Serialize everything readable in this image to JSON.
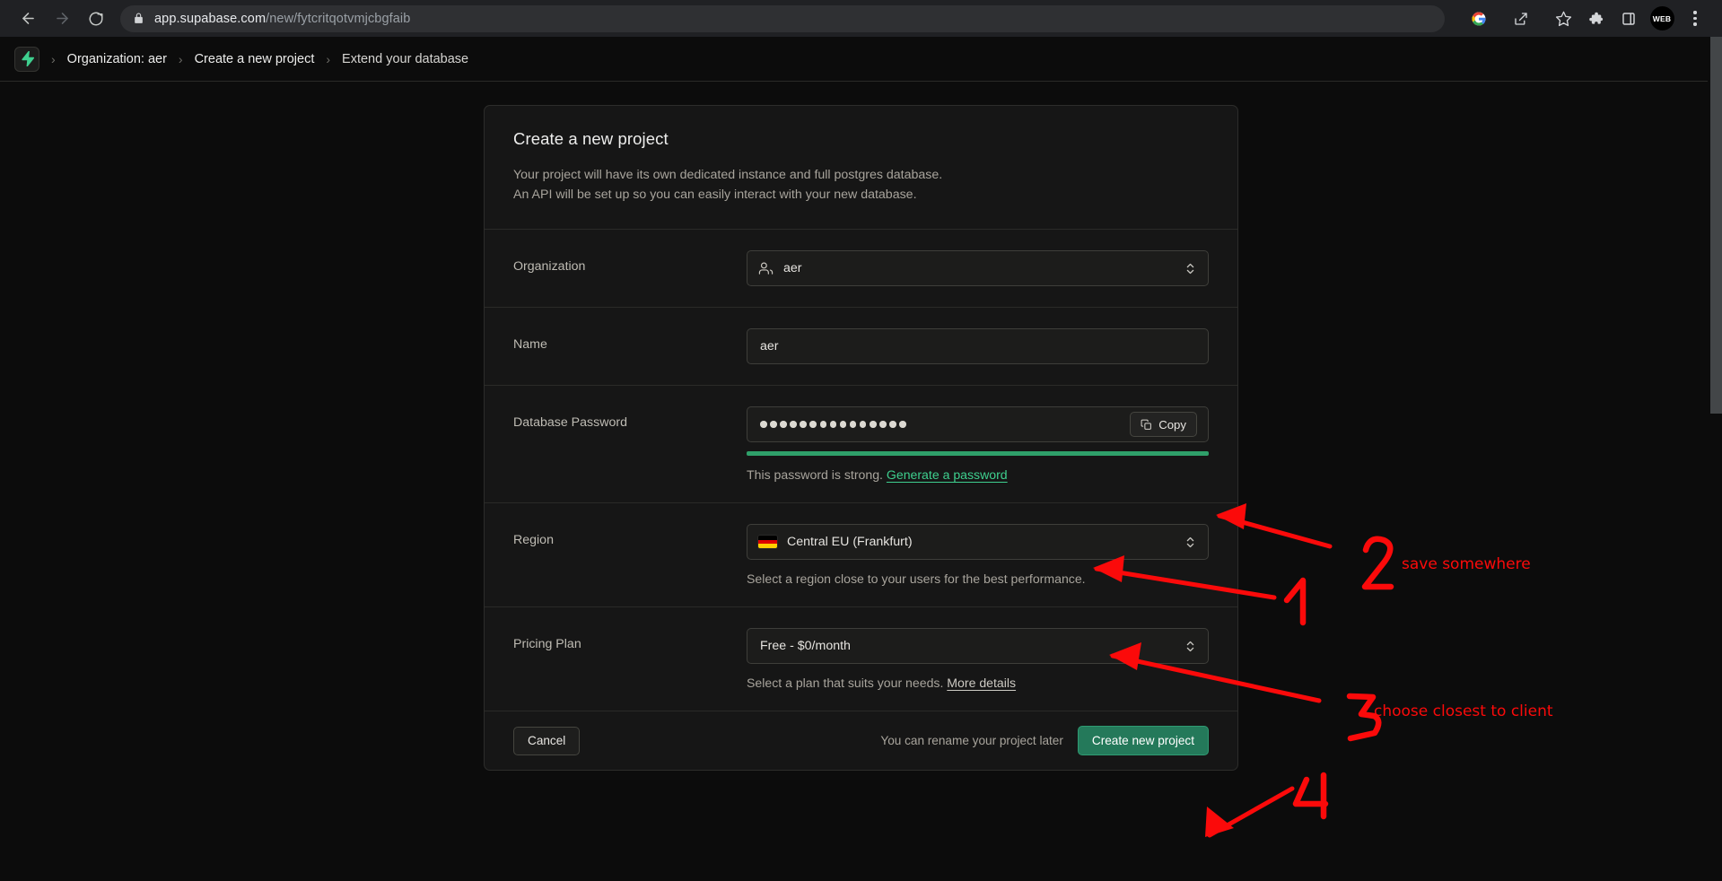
{
  "browser": {
    "back_icon": "arrow-left-icon",
    "forward_icon": "arrow-right-icon",
    "reload_icon": "reload-icon",
    "lock_icon": "lock-icon",
    "url_host": "app.supabase.com",
    "url_path": "/new/fytcritqotvmjcbgfaib",
    "url_full": "app.supabase.com/new/fytcritqotvmjcbgfaib",
    "toolbar_icons": [
      "google-icon",
      "share-icon",
      "bookmark-star-icon",
      "extensions-puzzle-icon",
      "side-panel-icon"
    ],
    "profile_label": "WEB",
    "menu_icon": "three-dot-menu-icon"
  },
  "breadcrumb": {
    "logo_icon": "supabase-lightning-icon",
    "separator": "›",
    "items": [
      {
        "label": "Organization: aer"
      },
      {
        "label": "Create a new project"
      },
      {
        "label": "Extend your database"
      }
    ]
  },
  "card": {
    "title": "Create a new project",
    "description_line1": "Your project will have its own dedicated instance and full postgres database.",
    "description_line2": "An API will be set up so you can easily interact with your new database.",
    "organization": {
      "label": "Organization",
      "icon": "users-icon",
      "value": "aer",
      "chevron_icon": "chevron-up-down-icon"
    },
    "name": {
      "label": "Name",
      "value": "aer",
      "placeholder": "Project name"
    },
    "password": {
      "label": "Database Password",
      "masked_value": "●●●●●●●●●●●●●●●",
      "dot_count": 15,
      "placeholder": "Type in a strong password",
      "copy_label": "Copy",
      "copy_icon": "copy-icon",
      "strength_text": "This password is strong.",
      "generate_link": "Generate a password",
      "strength_color": "#2fa06a",
      "strength_percent": 100
    },
    "region": {
      "label": "Region",
      "flag_icon": "flag-germany-icon",
      "value": "Central EU (Frankfurt)",
      "chevron_icon": "chevron-up-down-icon",
      "helper": "Select a region close to your users for the best performance."
    },
    "pricing": {
      "label": "Pricing Plan",
      "value": "Free - $0/month",
      "chevron_icon": "chevron-up-down-icon",
      "helper_prefix": "Select a plan that suits your needs.",
      "helper_link": "More details"
    },
    "footer": {
      "cancel_label": "Cancel",
      "note": "You can rename your project later",
      "submit_label": "Create new project",
      "submit_color": "#24795a"
    }
  },
  "annotations": {
    "color": "#fb0a0a",
    "items": [
      {
        "number": "1",
        "text": ""
      },
      {
        "number": "2",
        "text": "save somewhere"
      },
      {
        "number": "3",
        "text": "choose closest to client"
      },
      {
        "number": "4",
        "text": ""
      }
    ]
  }
}
